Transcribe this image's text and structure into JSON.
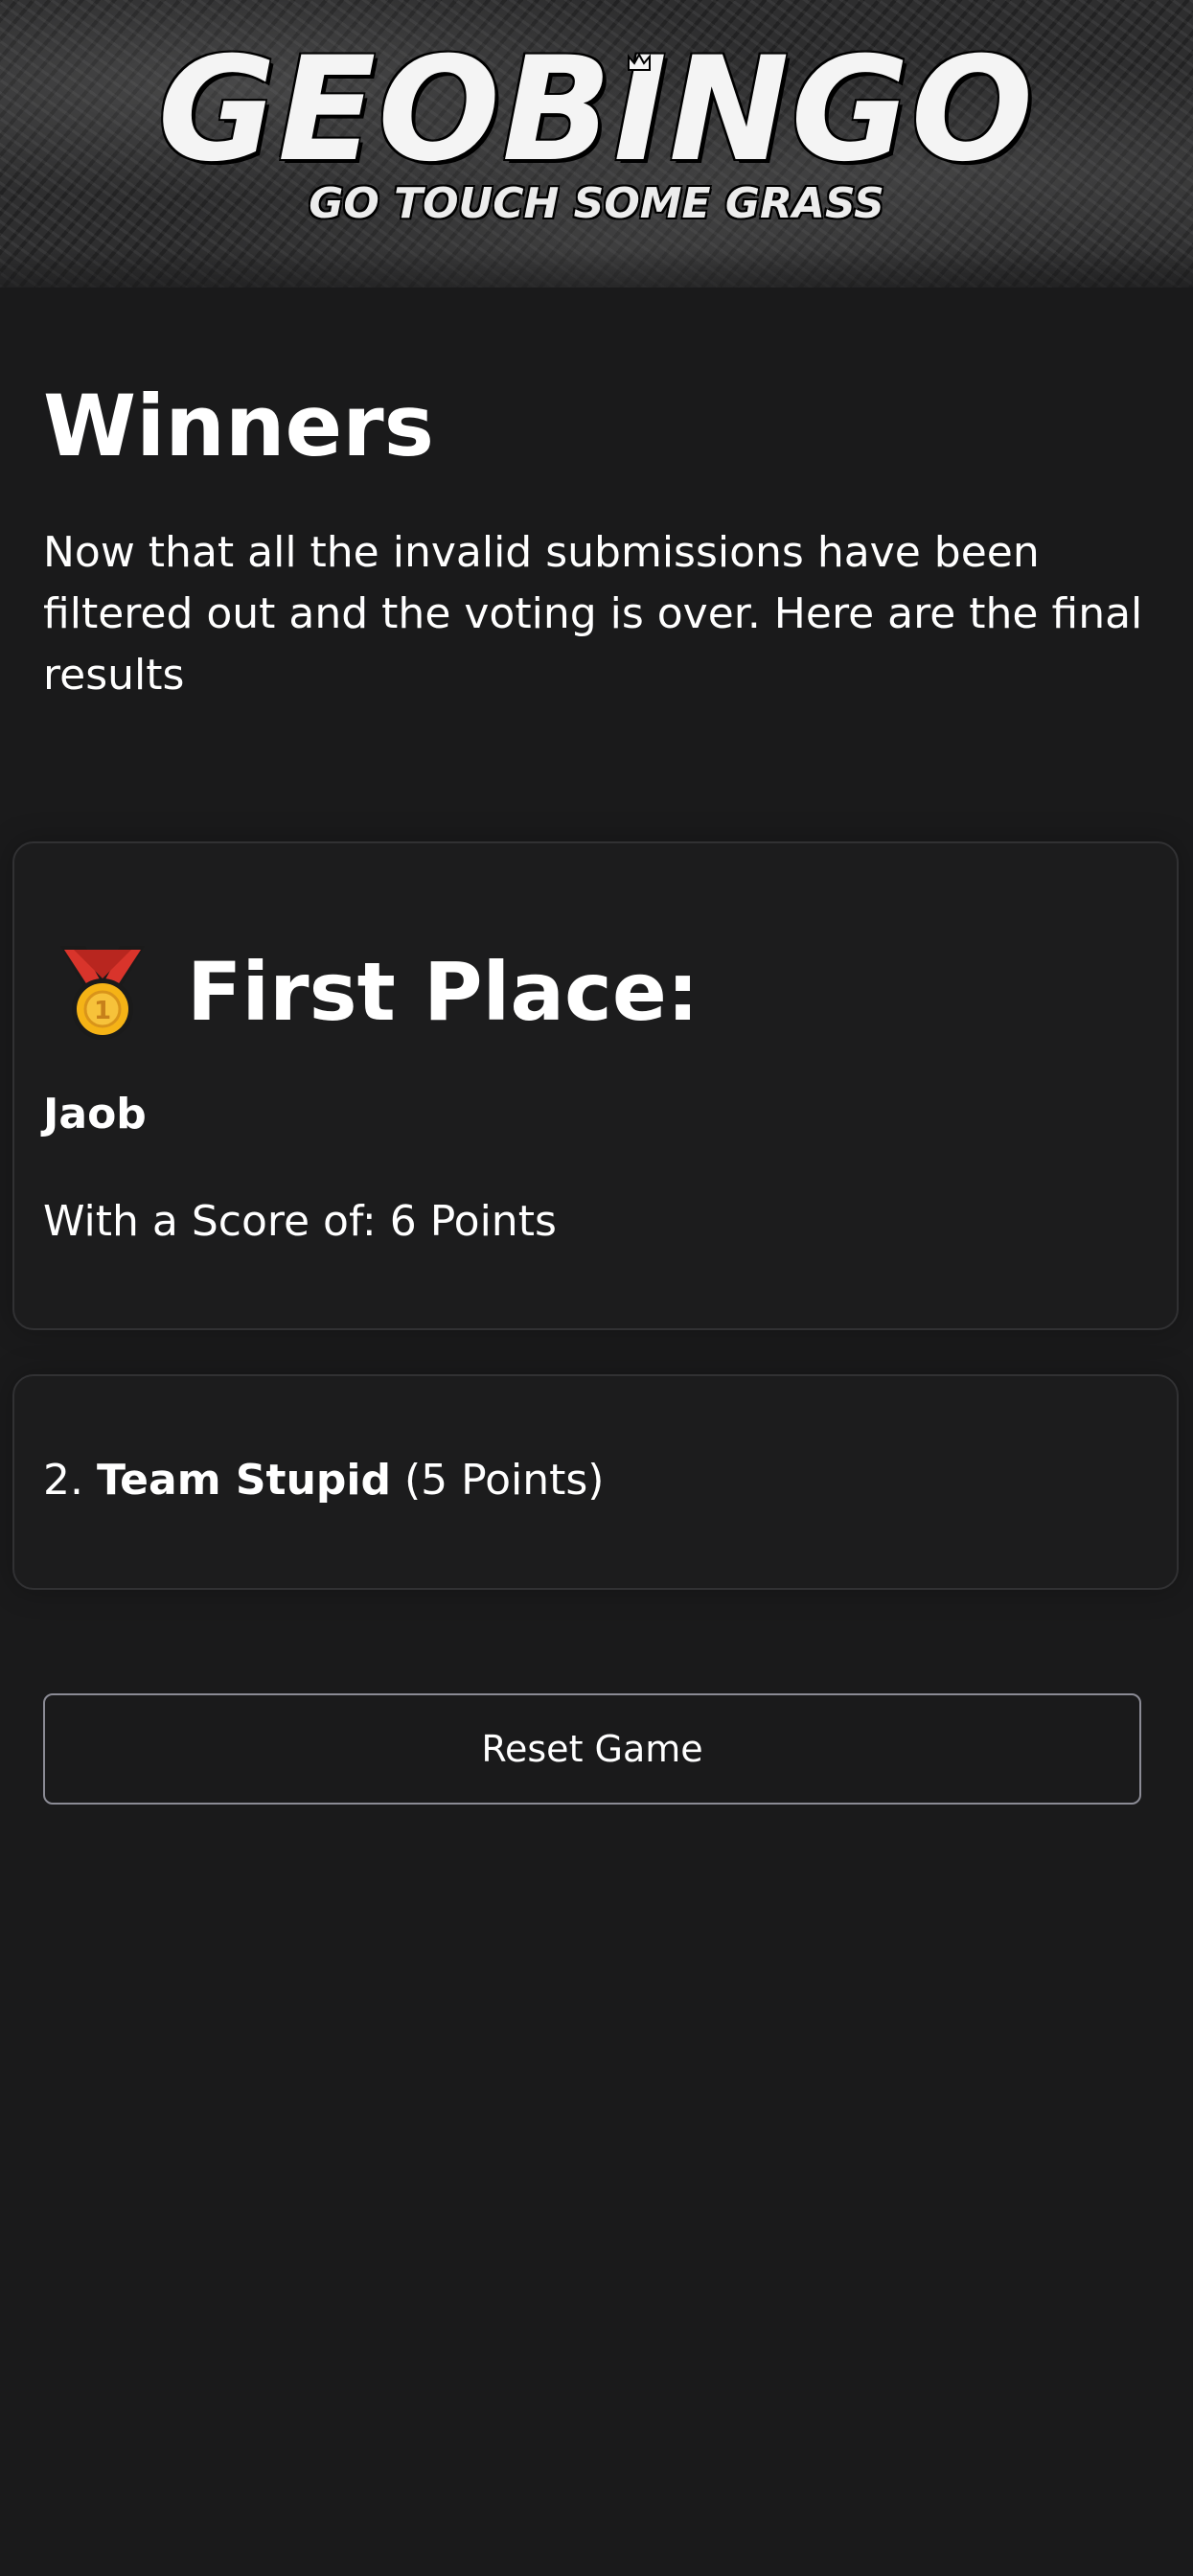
{
  "header": {
    "logo_title": "GEOBINGO",
    "logo_tagline": "GO TOUCH SOME GRASS"
  },
  "page": {
    "title": "Winners",
    "intro": "Now that all the invalid submissions have been filtered out and the voting is over. Here are the final results"
  },
  "first_place": {
    "icon": "gold-medal-icon",
    "label": "First Place:",
    "name": "Jaob",
    "score_text": "With a Score of: 6 Points"
  },
  "runners_up": [
    {
      "rank_text": "2.",
      "name": "Team Stupid",
      "points_text": "(5 Points)"
    }
  ],
  "actions": {
    "reset_label": "Reset Game"
  },
  "colors": {
    "background": "#1a1a1b",
    "card_border": "#313133",
    "button_border": "#8b8b95",
    "medal_gold": "#f5b316",
    "ribbon_red": "#d9342b"
  }
}
